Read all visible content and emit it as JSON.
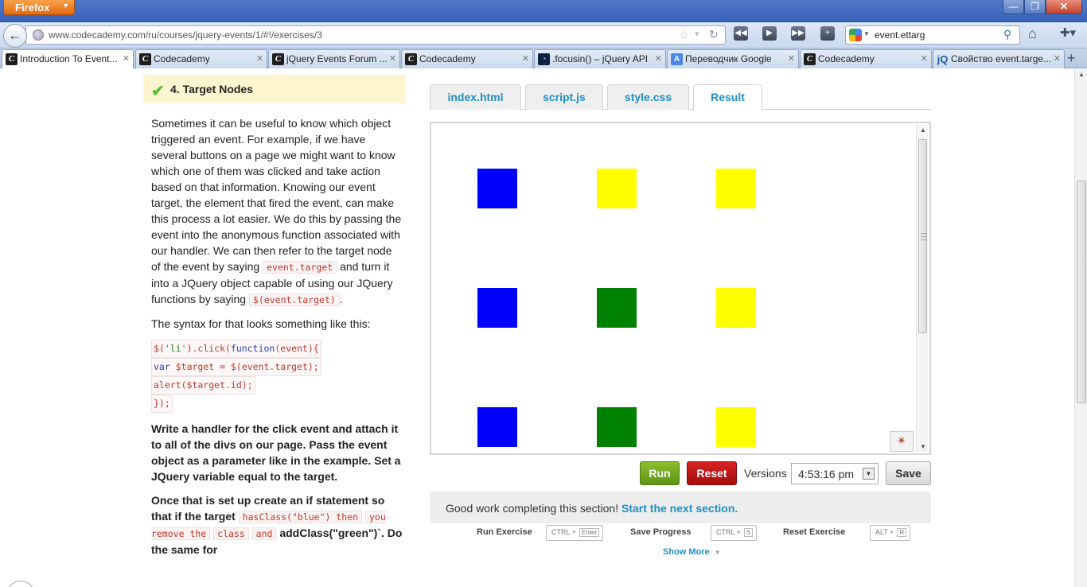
{
  "browser": {
    "menu_label": "Firefox",
    "url": "www.codecademy.com/ru/courses/jquery-events/1/#!/exercises/3",
    "search_text": "event.ettarg",
    "tabs": [
      {
        "title": "Introduction To Event...",
        "icon": "codecademy-icon",
        "active": true
      },
      {
        "title": "Codecademy",
        "icon": "codecademy-icon"
      },
      {
        "title": "jQuery Events Forum ...",
        "icon": "codecademy-icon"
      },
      {
        "title": "Codecademy",
        "icon": "codecademy-icon"
      },
      {
        "title": ".focusin() – jQuery API",
        "icon": "jquery-icon"
      },
      {
        "title": "Переводчик Google",
        "icon": "google-translate-icon"
      },
      {
        "title": "Codecademy",
        "icon": "codecademy-icon"
      },
      {
        "title": "Свойство event.targe...",
        "icon": "jquery-icon"
      }
    ]
  },
  "lesson": {
    "title": "4. Target Nodes",
    "p1_a": "Sometimes it can be useful to know which object triggered an event. For example, if we have several buttons on a page we might want to know which one of them was clicked and take action based on that information. Knowing our event target, the element that fired the event, can make this process a lot easier. We do this by passing the event into the anonymous function associated with our handler. We can then refer to the target node of the event by saying",
    "p1_code1": "event.target",
    "p1_b": "and turn it into a JQuery object capable of using our JQuery functions by saying",
    "p1_code2": "$(event.target)",
    "p1_c": ".",
    "p2": "The syntax for that looks something like this:",
    "code_lines": [
      "$('li').click(function(event){",
      "var $target = $(event.target);",
      "alert($target.id);",
      "});"
    ],
    "p3": "Write a handler for the click event and attach it to all of the divs on our page. Pass the event object as a parameter like in the example. Set a JQuery variable equal to the target.",
    "p4_a": "Once that is set up create an if statement so that if the target",
    "p4_code1": "hasClass(\"blue\") then",
    "p4_code2": "you remove the",
    "p4_code3": "class",
    "p4_code4": "and",
    "p4_b": "addClass(\"green\")`. Do the same for"
  },
  "editor": {
    "tabs": [
      "index.html",
      "script.js",
      "style.css",
      "Result"
    ],
    "active_tab": "Result",
    "run_label": "Run",
    "reset_label": "Reset",
    "versions_label": "Versions",
    "versions_value": "4:53:16 pm",
    "save_label": "Save",
    "squares": [
      [
        "blue",
        "yellow",
        "yellow"
      ],
      [
        "blue",
        "green",
        "yellow"
      ],
      [
        "blue",
        "green",
        "yellow"
      ]
    ],
    "colors": {
      "blue": "#0000ff",
      "yellow": "#ffff00",
      "green": "#008000",
      "link": "#1f8fc6",
      "run": "#6aa11c",
      "reset": "#b81313"
    }
  },
  "footer": {
    "good_work": "Good work completing this section!",
    "next_link": "Start the next section.",
    "shortcuts": [
      {
        "label": "Run Exercise",
        "key": "CTRL +",
        "sub": "Enter"
      },
      {
        "label": "Save Progress",
        "key": "CTRL +",
        "sub": "S"
      },
      {
        "label": "Reset Exercise",
        "key": "ALT +",
        "sub": "R"
      }
    ],
    "show_more": "Show More"
  }
}
